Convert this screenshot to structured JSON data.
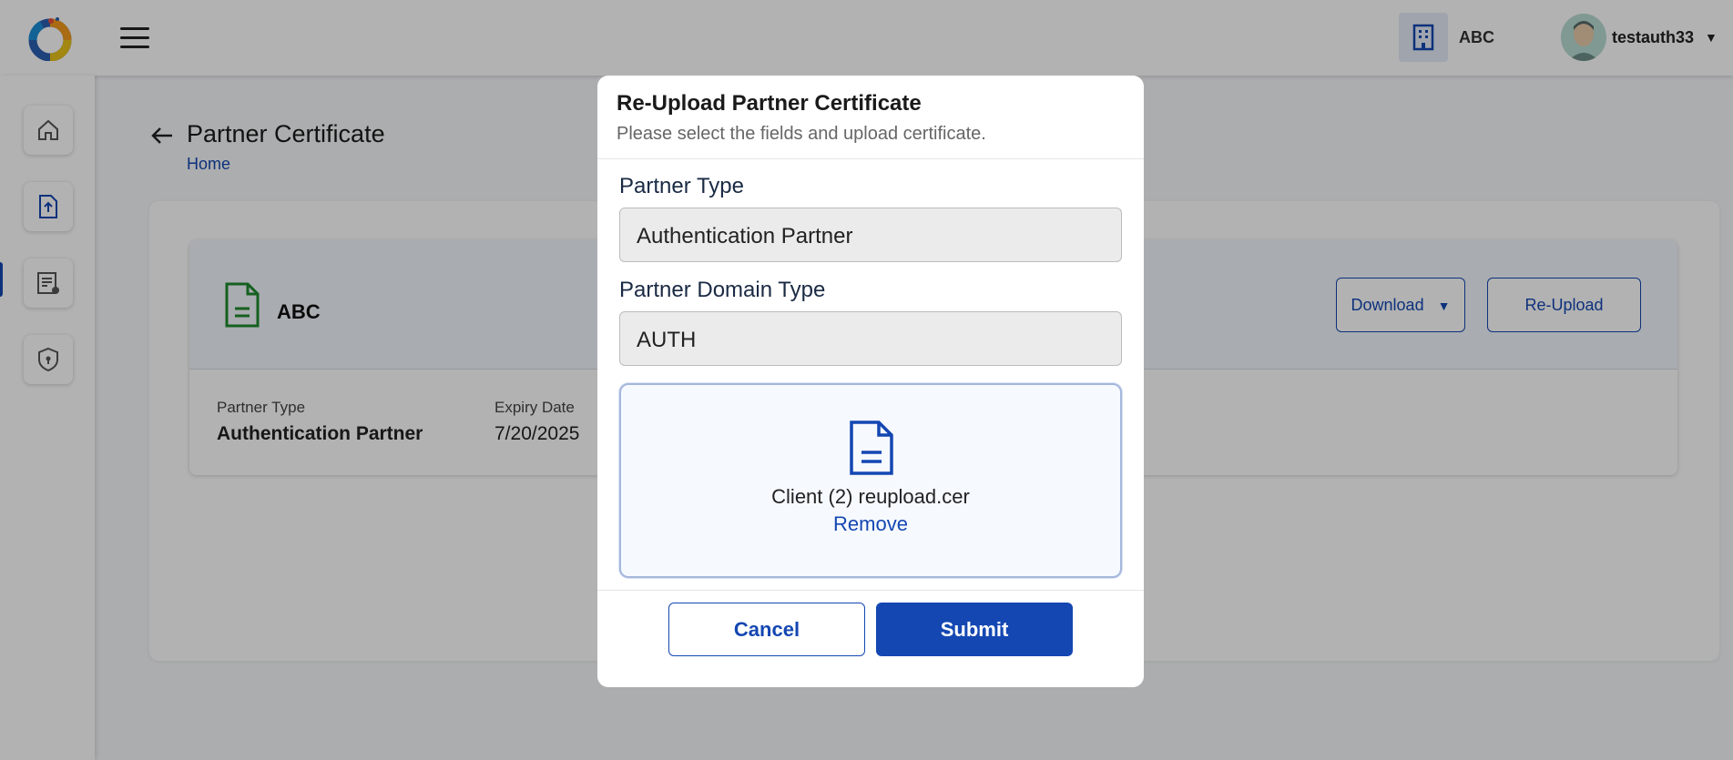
{
  "header": {
    "org_name": "ABC",
    "user_name": "testauth33",
    "caret": "▼"
  },
  "page": {
    "back_arrow": "←",
    "title": "Partner Certificate",
    "breadcrumb": "Home"
  },
  "certificate_card": {
    "name": "ABC",
    "download_label": "Download",
    "download_caret": "▼",
    "reupload_label": "Re-Upload",
    "partner_type_label": "Partner Type",
    "partner_type_value": "Authentication Partner",
    "expiry_label": "Expiry Date",
    "expiry_value": "7/20/2025"
  },
  "modal": {
    "title": "Re-Upload Partner Certificate",
    "subtitle": "Please select the fields and upload certificate.",
    "partner_type_label": "Partner Type",
    "partner_type_value": "Authentication Partner",
    "domain_type_label": "Partner Domain Type",
    "domain_type_value": "AUTH",
    "file_name": "Client (2) reupload.cer",
    "remove_label": "Remove",
    "cancel_label": "Cancel",
    "submit_label": "Submit"
  },
  "colors": {
    "primary": "#1447b2",
    "success_icon": "#1f8a2e",
    "overlay": "rgba(0,0,0,0.3)"
  },
  "icons": {
    "sidebar": [
      "home-icon",
      "upload-document-icon",
      "policy-document-icon",
      "shield-icon"
    ],
    "header": [
      "logo",
      "hamburger-menu-icon",
      "building-icon",
      "avatar"
    ]
  }
}
